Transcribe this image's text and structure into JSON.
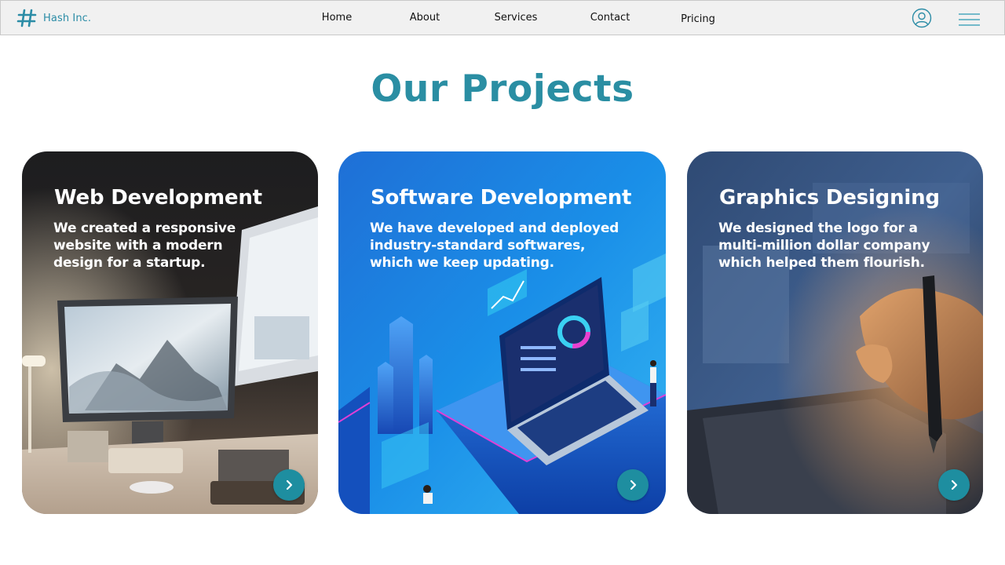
{
  "brand": {
    "name": "Hash Inc.",
    "icon": "hash-icon"
  },
  "nav": {
    "items": [
      {
        "label": "Home"
      },
      {
        "label": "About"
      },
      {
        "label": "Services"
      },
      {
        "label": "Contact"
      },
      {
        "label": "Pricing"
      }
    ],
    "profile_icon": "user-circle-icon",
    "menu_icon": "hamburger-menu-icon"
  },
  "section": {
    "title": "Our Projects"
  },
  "cards": [
    {
      "title": "Web Development",
      "description": "We created a responsive\nwebsite with a modern\ndesign for a startup.",
      "image": "desk-computer-photo",
      "arrow_icon": "chevron-right-icon"
    },
    {
      "title": "Software Development",
      "description": "We have developed and deployed\nindustry-standard softwares,\nwhich we keep updating.",
      "image": "isometric-laptop-illustration",
      "arrow_icon": "chevron-right-icon"
    },
    {
      "title": "Graphics Designing",
      "description": "We designed the logo for a\nmulti-million dollar company\nwhich helped them flourish.",
      "image": "pen-tablet-photo",
      "arrow_icon": "chevron-right-icon"
    }
  ],
  "colors": {
    "accent": "#2a8ea3",
    "navbar_bg": "#f1f1f1",
    "arrow_button": "#1e8ea0"
  }
}
